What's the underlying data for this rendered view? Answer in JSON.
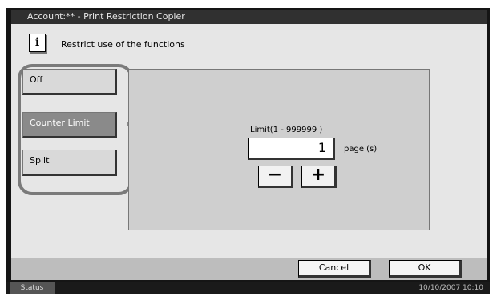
{
  "window": {
    "title": "Account:** - Print Restriction Copier"
  },
  "info": {
    "icon": "info-icon",
    "icon_glyph": "i",
    "message": "Restrict use of the functions"
  },
  "options": [
    {
      "label": "Off",
      "selected": false
    },
    {
      "label": "Counter Limit",
      "selected": true
    },
    {
      "label": "Split",
      "selected": false
    }
  ],
  "limit": {
    "label": "Limit(1 - 999999 )",
    "value": "1",
    "unit": "page (s)",
    "minus": "−",
    "plus": "+"
  },
  "footer": {
    "cancel": "Cancel",
    "ok": "OK"
  },
  "status_bar": {
    "status": "Status",
    "datetime": "10/10/2007  10:10"
  }
}
